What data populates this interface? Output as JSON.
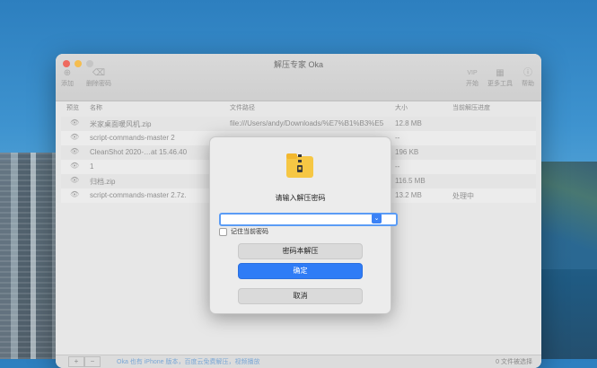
{
  "window": {
    "title": "解压专家 Oka",
    "toolbar_left": [
      {
        "label": "添加",
        "icon": "plus-icon"
      },
      {
        "label": "删除密码",
        "icon": "trash-icon"
      }
    ],
    "toolbar_right": [
      {
        "label": "开始",
        "icon_text": "VIP"
      },
      {
        "label": "更多工具",
        "icon": "grid-icon"
      },
      {
        "label": "帮助",
        "icon": "info-icon"
      }
    ]
  },
  "table": {
    "headers": {
      "preview": "预览",
      "name": "名称",
      "path": "文件路径",
      "size": "大小",
      "progress": "当前解压进度"
    },
    "rows": [
      {
        "name": "米家桌面暖风机.zip",
        "path": "file:///Users/andy/Downloads/%E7%B1%B3%E5",
        "size": "12.8 MB",
        "progress": ""
      },
      {
        "name": "script-commands-master 2",
        "path": "",
        "size": "--",
        "progress": ""
      },
      {
        "name": "CleanShot 2020-…at 15.46.40",
        "path": "",
        "size": "196 KB",
        "progress": ""
      },
      {
        "name": "1",
        "path": "",
        "size": "--",
        "progress": ""
      },
      {
        "name": "归档.zip",
        "path": "",
        "size": "116.5 MB",
        "progress": ""
      },
      {
        "name": "script-commands-master 2.7z.",
        "path": "",
        "size": "13.2 MB",
        "progress": "处理中"
      }
    ]
  },
  "footer": {
    "add": "+",
    "remove": "−",
    "promo": "Oka 也有 iPhone 版本，百度云免费解压，视频播放",
    "count": "0 文件被选择"
  },
  "dialog": {
    "title": "请输入解压密码",
    "password_value": "",
    "remember_label": "记住当前密码",
    "book_button": "密码本解压",
    "ok_button": "确定",
    "cancel_button": "取消"
  },
  "colors": {
    "accent": "#2f7cf6",
    "zip_yellow": "#f6c744"
  }
}
